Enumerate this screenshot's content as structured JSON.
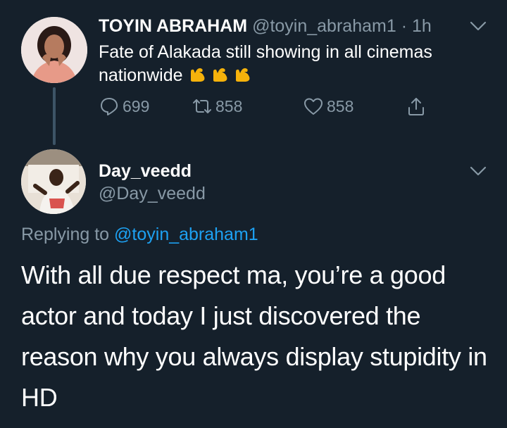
{
  "parent_tweet": {
    "display_name": "TOYIN ABRAHAM",
    "handle": "@toyin_abraham1",
    "separator": "·",
    "time": "1h",
    "text": "Fate of Alakada still showing in all cinemas nationwide",
    "emoji": [
      "flexed-biceps",
      "flexed-biceps",
      "flexed-biceps"
    ],
    "reply_count": "699",
    "retweet_count": "858",
    "like_count": "858"
  },
  "reply_tweet": {
    "display_name": "Day_veedd",
    "handle": "@Day_veedd",
    "replying_to_label": "Replying to",
    "replying_to_handle": "@toyin_abraham1",
    "text": "With all due respect ma, you’re a good actor and today I just discovered the reason why you always display stupidity in HD"
  },
  "colors": {
    "background": "#15202b",
    "text": "#ffffff",
    "muted": "#8899a6",
    "link": "#1da1f2",
    "emoji": "#f5b20b"
  }
}
